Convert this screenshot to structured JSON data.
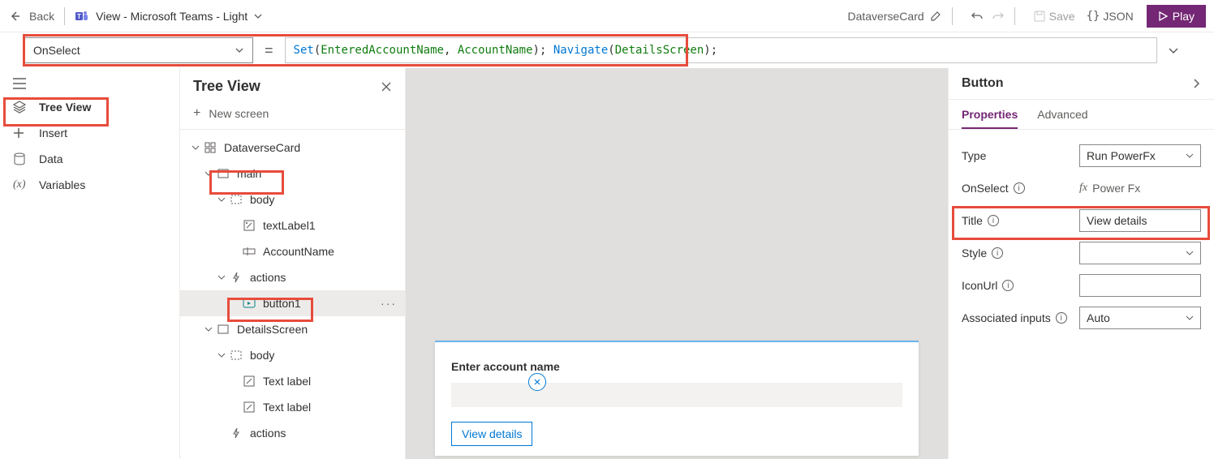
{
  "header": {
    "back": "Back",
    "view_label": "View - Microsoft Teams - Light",
    "card_name": "DataverseCard",
    "save": "Save",
    "json": "JSON",
    "play": "Play"
  },
  "formula": {
    "property": "OnSelect",
    "set": "Set",
    "arg1": "EnteredAccountName",
    "arg2": "AccountName",
    "nav": "Navigate",
    "arg3": "DetailsScreen"
  },
  "rail": {
    "tree_view": "Tree View",
    "insert": "Insert",
    "data": "Data",
    "variables": "Variables"
  },
  "tree": {
    "title": "Tree View",
    "new_screen": "New screen",
    "root": "DataverseCard",
    "main": "main",
    "body": "body",
    "textlabel1": "textLabel1",
    "accountname": "AccountName",
    "actions": "actions",
    "button1": "button1",
    "details": "DetailsScreen",
    "body2": "body",
    "textlabel_a": "Text label",
    "textlabel_b": "Text label",
    "actions2": "actions"
  },
  "card": {
    "label": "Enter account name",
    "button": "View details"
  },
  "props": {
    "title": "Button",
    "tab_props": "Properties",
    "tab_adv": "Advanced",
    "type_label": "Type",
    "type_value": "Run PowerFx",
    "onselect_label": "OnSelect",
    "onselect_value": "Power Fx",
    "title_label": "Title",
    "title_value": "View details",
    "style_label": "Style",
    "iconurl_label": "IconUrl",
    "assoc_label": "Associated inputs",
    "assoc_value": "Auto"
  }
}
